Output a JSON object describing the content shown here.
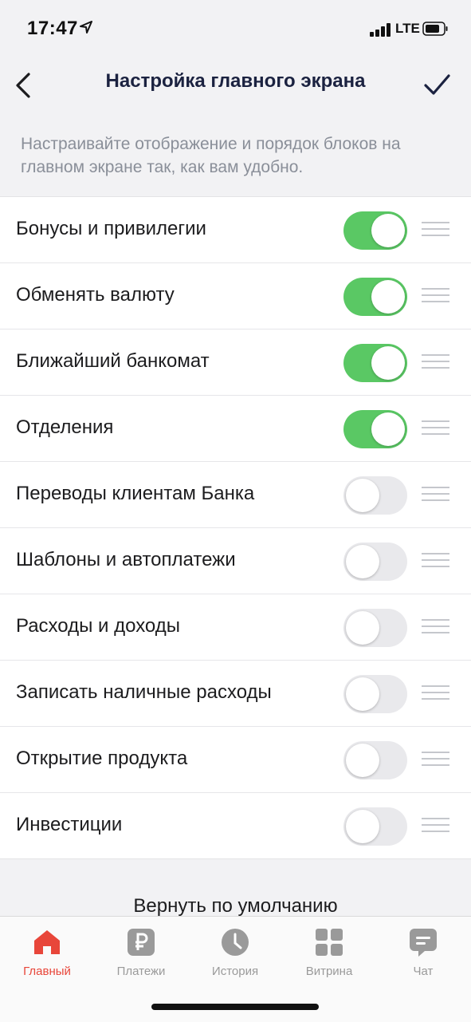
{
  "status": {
    "time": "17:47",
    "network": "LTE"
  },
  "nav": {
    "title": "Настройка главного экрана"
  },
  "hint": "Настраивайте отображение и порядок блоков на главном экране так, как вам удобно.",
  "items": [
    {
      "label": "Бонусы и привилегии",
      "enabled": true
    },
    {
      "label": "Обменять валюту",
      "enabled": true
    },
    {
      "label": "Ближайший банкомат",
      "enabled": true
    },
    {
      "label": "Отделения",
      "enabled": true
    },
    {
      "label": "Переводы клиентам Банка",
      "enabled": false
    },
    {
      "label": "Шаблоны и автоплатежи",
      "enabled": false
    },
    {
      "label": "Расходы и доходы",
      "enabled": false
    },
    {
      "label": "Записать наличные расходы",
      "enabled": false
    },
    {
      "label": "Открытие продукта",
      "enabled": false
    },
    {
      "label": "Инвестиции",
      "enabled": false
    }
  ],
  "reset_label": "Вернуть по умолчанию",
  "tabs": [
    {
      "label": "Главный",
      "icon": "home-icon",
      "active": true
    },
    {
      "label": "Платежи",
      "icon": "ruble-icon",
      "active": false
    },
    {
      "label": "История",
      "icon": "clock-icon",
      "active": false
    },
    {
      "label": "Витрина",
      "icon": "grid-icon",
      "active": false
    },
    {
      "label": "Чат",
      "icon": "chat-icon",
      "active": false
    }
  ],
  "colors": {
    "accent": "#e8463a",
    "toggle_on": "#5ac864",
    "title": "#1b2240"
  }
}
